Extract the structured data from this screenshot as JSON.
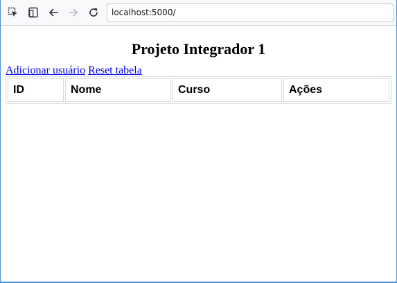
{
  "browser": {
    "url": "localhost:5000/",
    "buttons": {
      "inspect_icon": "pick-element-icon",
      "responsive_icon": "responsive-design-icon",
      "back_icon": "back-arrow-icon",
      "forward_icon": "forward-arrow-icon",
      "reload_icon": "reload-icon"
    }
  },
  "page": {
    "title": "Projeto Integrador 1",
    "links": {
      "add_user": "Adicionar usuário",
      "reset_table": "Reset tabela"
    },
    "table": {
      "columns": [
        "ID",
        "Nome",
        "Curso",
        "Ações"
      ],
      "rows": []
    }
  }
}
